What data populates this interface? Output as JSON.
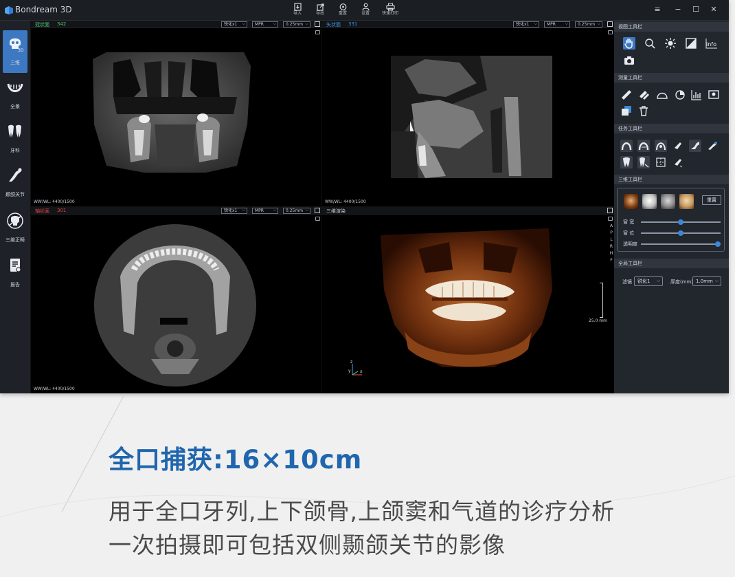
{
  "app": {
    "title": "Bondream 3D"
  },
  "toolbar": [
    {
      "label": "导入",
      "icon": "import-icon"
    },
    {
      "label": "导出",
      "icon": "export-icon"
    },
    {
      "label": "重置",
      "icon": "reset-icon"
    },
    {
      "label": "设置",
      "icon": "settings-icon"
    },
    {
      "label": "快速打印",
      "icon": "print-icon"
    }
  ],
  "sidebar": [
    {
      "label": "三维",
      "icon": "skull-3d-icon"
    },
    {
      "label": "全景",
      "icon": "panorama-arch-icon"
    },
    {
      "label": "牙科",
      "icon": "teeth-icon"
    },
    {
      "label": "颞颌关节",
      "icon": "tmj-icon"
    },
    {
      "label": "三维正畸",
      "icon": "orthodontic-icon"
    },
    {
      "label": "报告",
      "icon": "report-icon"
    }
  ],
  "viewports": {
    "coronal": {
      "name": "冠状面",
      "num": "342",
      "sharpen": "锐化x1",
      "mode": "MPR",
      "thickness": "0.25mm",
      "wwwl": "WW/WL: 4400/1500"
    },
    "sagittal": {
      "name": "矢状面",
      "num": "331",
      "sharpen": "锐化x1",
      "mode": "MPR",
      "thickness": "0.25mm",
      "wwwl": "WW/WL: 4400/1500"
    },
    "axial": {
      "name": "轴状面",
      "num": "301",
      "sharpen": "锐化x1",
      "mode": "MPR",
      "thickness": "0.25mm",
      "wwwl": "WW/WL: 4400/1500"
    },
    "render3d": {
      "name": "三维渲染",
      "scale": "25.0 mm",
      "orient": [
        "A",
        "P",
        "L",
        "R",
        "H",
        "F"
      ],
      "axis": {
        "z": "z",
        "y": "y",
        "x": "x"
      }
    }
  },
  "right_panel": {
    "view_tools_title": "视图工具栏",
    "measure_tools_title": "测量工具栏",
    "task_tools_title": "任务工具栏",
    "render3d_tools_title": "三维工具栏",
    "reset_label": "重置",
    "sliders": [
      {
        "label": "窗 宽",
        "value": 0.5
      },
      {
        "label": "窗 位",
        "value": 0.5
      },
      {
        "label": "透明度",
        "value": 1.0
      }
    ],
    "global_tools_title": "全局工具栏",
    "filter_label": "滤镜",
    "filter_value": "锐化1",
    "thickness_label": "厚度(mm)",
    "thickness_value": "1.0mm"
  },
  "caption": {
    "title": "全口捕获:16×10cm",
    "line1": "用于全口牙列,上下颌骨,上颌窦和气道的诊疗分析",
    "line2": "一次拍摄即可包括双侧颞颌关节的影像"
  },
  "colors": {
    "accent": "#3d79c2",
    "caption_title": "#1f66ae",
    "coronal_label": "#4fc36a",
    "sagittal_label": "#3d8fe0",
    "axial_label": "#e04646"
  }
}
